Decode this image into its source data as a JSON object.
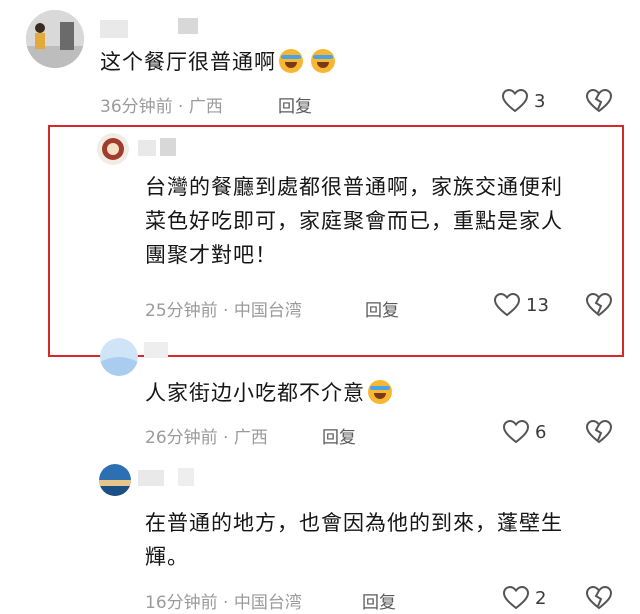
{
  "comments": [
    {
      "text": "这个餐厅很普通啊",
      "time": "36分钟前 · 广西",
      "reply": "回复",
      "likes": "3",
      "emoji_count": 2
    },
    {
      "text": "台灣的餐廳到處都很普通啊，家族交通便利菜色好吃即可，家庭聚會而已，重點是家人團聚才對吧！",
      "line1": "台灣的餐廳到處都很普通啊，家族交通便利",
      "line2": "菜色好吃即可，家庭聚會而已，重點是家人",
      "line3": "團聚才對吧！",
      "time": "25分钟前 · 中国台湾",
      "reply": "回复",
      "likes": "13"
    },
    {
      "text": "人家街边小吃都不介意",
      "time": "26分钟前 · 广西",
      "reply": "回复",
      "likes": "6",
      "emoji_count": 1
    },
    {
      "text": "在普通的地方，也會因為他的到來，蓬壁生輝。",
      "line1": "在普通的地方，也會因為他的到來，蓬壁生",
      "line2": "輝。",
      "time": "16分钟前 · 中国台湾",
      "reply": "回复",
      "likes": "2"
    }
  ],
  "icons": {
    "like": "heart-outline-icon",
    "dislike": "broken-heart-icon"
  },
  "colors": {
    "highlight_border": "#d62828",
    "meta_text": "#9b9b9b"
  }
}
